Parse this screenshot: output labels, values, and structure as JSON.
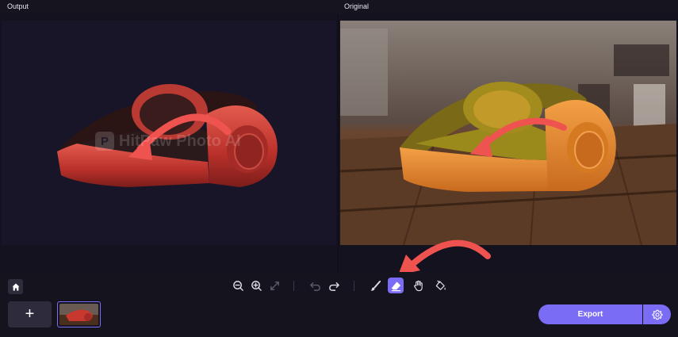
{
  "panes": {
    "output_label": "Output",
    "original_label": "Original",
    "watermark_text": "HitPaw Photo AI"
  },
  "toolbar": {
    "icons": [
      "home-icon",
      "zoom-out-icon",
      "zoom-in-icon",
      "fit-screen-icon",
      "undo-icon",
      "redo-icon",
      "brush-icon",
      "eraser-icon",
      "hand-icon",
      "fill-icon"
    ],
    "active_tool": "eraser"
  },
  "bottom": {
    "add_label": "+",
    "export_label": "Export"
  },
  "colors": {
    "accent": "#7a6cf5",
    "panel_bg": "#181528",
    "headphone_red": "#c83a32",
    "headphone_orange": "#e88a2c",
    "arrow_red": "#ef5350"
  }
}
